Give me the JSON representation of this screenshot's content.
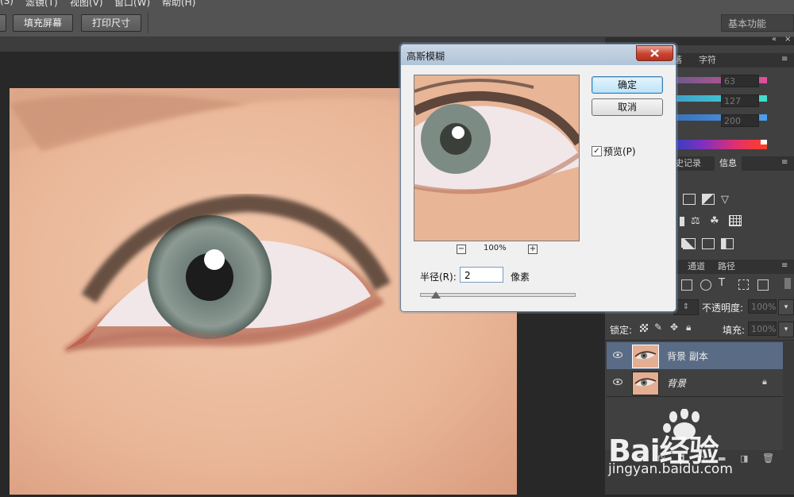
{
  "menubar": {
    "items": [
      "(S)",
      "滤镜(T)",
      "视图(V)",
      "窗口(W)",
      "帮助(H)"
    ]
  },
  "options_bar": {
    "fill_screen_label": "填充屏幕",
    "print_size_label": "打印尺寸",
    "workspace_label": "基本功能"
  },
  "color_panel": {
    "tabs": [
      "落",
      "字符"
    ],
    "r_value": "63",
    "g_value": "127",
    "b_value": "200"
  },
  "history_panel": {
    "tabs": [
      "史记录",
      "信息"
    ]
  },
  "layers_panel": {
    "tabs": [
      "通道",
      "路径"
    ],
    "opacity_label": "不透明度:",
    "opacity_value": "100%",
    "lock_label": "锁定:",
    "fill_label": "填充:",
    "fill_value": "100%",
    "layers": [
      {
        "name": "背景 副本",
        "selected": true
      },
      {
        "name": "背景",
        "selected": false
      }
    ]
  },
  "dialog": {
    "title": "高斯模糊",
    "ok_label": "确定",
    "cancel_label": "取消",
    "preview_label": "预览(P)",
    "preview_checked": "✓",
    "zoom_minus": "−",
    "zoom_plus": "+",
    "zoom_level": "100%",
    "radius_label": "半径(R):",
    "radius_value": "2",
    "radius_unit": "像素"
  },
  "watermark": {
    "logo_text": "Bai经验",
    "url": "jingyan.baidu.com"
  },
  "colors": {
    "skin": "#e8b79a",
    "iris": "#7f8f86",
    "panel_bg": "#404040",
    "dialog_bg": "#f0f0f0"
  }
}
